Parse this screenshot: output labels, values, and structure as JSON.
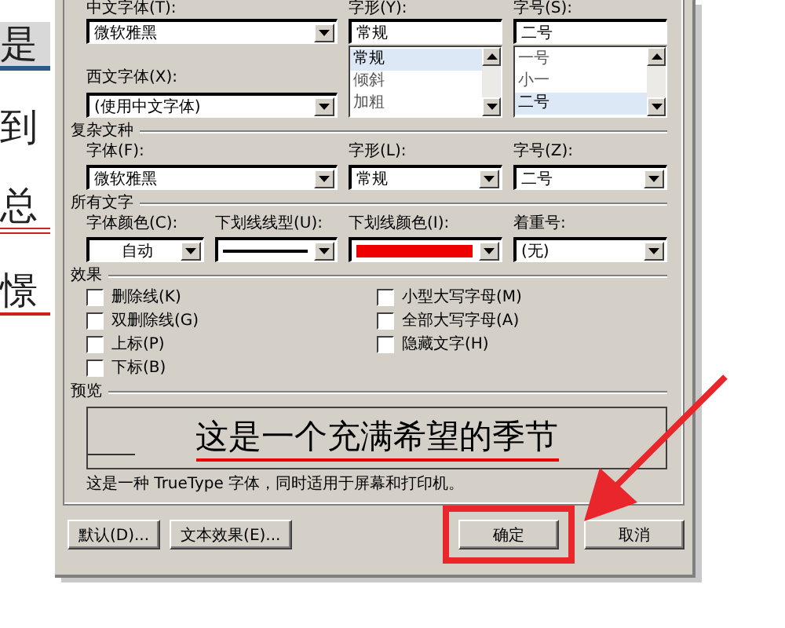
{
  "document_fragments": [
    {
      "text": "是",
      "kind": "highlight"
    },
    {
      "text": "到",
      "kind": "plain"
    },
    {
      "text": "总",
      "kind": "double_underline"
    },
    {
      "text": "憬",
      "kind": "underline"
    }
  ],
  "dialog": {
    "chinese_font": {
      "label": "中文字体(T):",
      "value": "微软雅黑"
    },
    "font_style": {
      "label": "字形(Y):",
      "value": "常规",
      "options": [
        {
          "label": "常规",
          "selected": true
        },
        {
          "label": "倾斜",
          "selected": false
        },
        {
          "label": "加粗",
          "selected": false
        }
      ]
    },
    "font_size": {
      "label": "字号(S):",
      "value": "二号",
      "options": [
        {
          "label": "一号",
          "selected": false
        },
        {
          "label": "小一",
          "selected": false
        },
        {
          "label": "二号",
          "selected": true
        }
      ]
    },
    "western_font": {
      "label": "西文字体(X):",
      "value": "(使用中文字体)"
    },
    "complex_script": {
      "title": "复杂文种",
      "font": {
        "label": "字体(F):",
        "value": "微软雅黑"
      },
      "style": {
        "label": "字形(L):",
        "value": "常规"
      },
      "size": {
        "label": "字号(Z):",
        "value": "二号"
      }
    },
    "all_text": {
      "title": "所有文字",
      "font_color": {
        "label": "字体颜色(C):",
        "value": "自动"
      },
      "underline_style": {
        "label": "下划线线型(U):"
      },
      "underline_color": {
        "label": "下划线颜色(I):",
        "color": "#ee0000"
      },
      "emphasis": {
        "label": "着重号:",
        "value": "(无)"
      }
    },
    "effects": {
      "title": "效果",
      "left_options": [
        {
          "label": "删除线(K)",
          "checked": false
        },
        {
          "label": "双删除线(G)",
          "checked": false
        },
        {
          "label": "上标(P)",
          "checked": false
        },
        {
          "label": "下标(B)",
          "checked": false
        }
      ],
      "right_options": [
        {
          "label": "小型大写字母(M)",
          "checked": false
        },
        {
          "label": "全部大写字母(A)",
          "checked": false
        },
        {
          "label": "隐藏文字(H)",
          "checked": false
        }
      ]
    },
    "preview": {
      "title": "预览",
      "sample": "这是一个充满希望的季节",
      "note": "这是一种 TrueType 字体，同时适用于屏幕和打印机。"
    },
    "buttons": [
      {
        "label": "默认(D)...",
        "kind": "left",
        "highlighted": false
      },
      {
        "label": "文本效果(E)...",
        "kind": "left",
        "highlighted": false
      },
      {
        "label": "确定",
        "kind": "right",
        "highlighted": true
      },
      {
        "label": "取消",
        "kind": "right",
        "highlighted": false
      }
    ]
  }
}
